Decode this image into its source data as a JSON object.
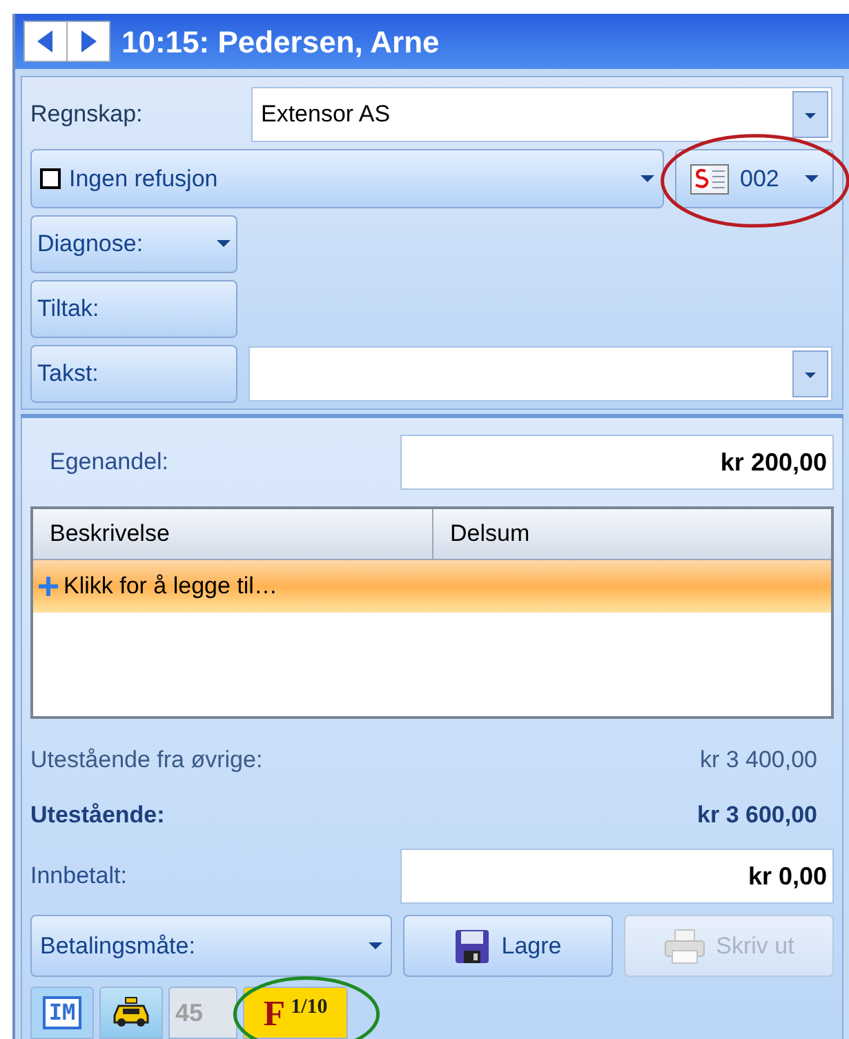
{
  "window": {
    "title": "10:15: Pedersen, Arne"
  },
  "regnskap": {
    "label": "Regnskap:",
    "value": "Extensor AS"
  },
  "refusjon": {
    "label": "Ingen refusjon",
    "checked": false
  },
  "series_button": {
    "label": "002",
    "highlight": {
      "color": "#b81c22"
    }
  },
  "side_buttons": [
    {
      "label": "Diagnose:",
      "dropdown": true
    },
    {
      "label": "Tiltak:",
      "dropdown": false
    },
    {
      "label": "Takst:",
      "dropdown": false
    }
  ],
  "egenandel": {
    "label": "Egenandel:",
    "value": "kr 200,00"
  },
  "table": {
    "columns": [
      "Beskrivelse",
      "Delsum"
    ],
    "add_row": "Klikk for å legge til…"
  },
  "summary": [
    {
      "label": "Utestående fra øvrige:",
      "value": "kr 3 400,00",
      "emphasis": false
    },
    {
      "label": "Utestående:",
      "value": "kr 3 600,00",
      "emphasis": true
    }
  ],
  "innbetalt": {
    "label": "Innbetalt:",
    "value": "kr 0,00"
  },
  "actions": [
    {
      "kind": "dropdown",
      "label": "Betalingsmåte:",
      "disabled": false
    },
    {
      "kind": "save",
      "label": "Lagre",
      "disabled": false
    },
    {
      "kind": "print",
      "label": "Skriv ut",
      "disabled": true
    }
  ],
  "status_tabs": [
    {
      "kind": "im",
      "label": "IM",
      "disabled": false
    },
    {
      "kind": "taxi",
      "disabled": false
    },
    {
      "kind": "text",
      "label": "45",
      "disabled": true
    },
    {
      "kind": "flag",
      "label": "F",
      "sub": "1/10",
      "disabled": false,
      "highlight": {
        "color": "#1f8a24"
      }
    }
  ]
}
